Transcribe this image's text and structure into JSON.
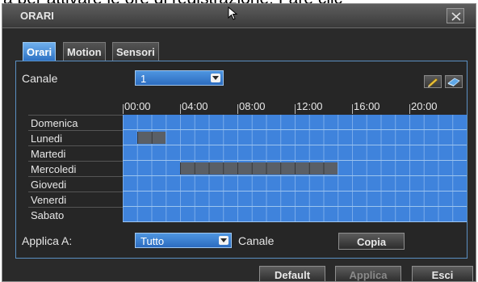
{
  "top_strip_text": "a  per attivare le ore di registrazione. Fare clic",
  "window": {
    "title": "ORARI",
    "close_glyph": "✕"
  },
  "tabs": [
    {
      "label": "Orari",
      "active": true
    },
    {
      "label": "Motion",
      "active": false
    },
    {
      "label": "Sensori",
      "active": false
    }
  ],
  "channel": {
    "label": "Canale",
    "value": "1"
  },
  "tools": {
    "edit_icon": "pencil-icon",
    "erase_icon": "eraser-icon"
  },
  "schedule": {
    "time_labels": [
      "00:00",
      "04:00",
      "08:00",
      "12:00",
      "16:00",
      "20:00"
    ],
    "slots_per_day": 24,
    "days": [
      {
        "label": "Domenica",
        "unscheduled_slots": []
      },
      {
        "label": "Lunedi",
        "unscheduled_slots": [
          [
            1,
            3
          ]
        ]
      },
      {
        "label": "Martedi",
        "unscheduled_slots": []
      },
      {
        "label": "Mercoledi",
        "unscheduled_slots": [
          [
            4,
            15
          ]
        ]
      },
      {
        "label": "Giovedi",
        "unscheduled_slots": []
      },
      {
        "label": "Venerdi",
        "unscheduled_slots": []
      },
      {
        "label": "Sabato",
        "unscheduled_slots": []
      }
    ],
    "colors": {
      "scheduled": "#3f83dc",
      "unscheduled": "#5a5f66"
    }
  },
  "apply_to": {
    "label": "Applica A:",
    "value": "Tutto",
    "suffix_label": "Canale",
    "copy_button": "Copia"
  },
  "footer": {
    "default_button": "Default",
    "apply_button": "Applica",
    "exit_button": "Esci"
  }
}
